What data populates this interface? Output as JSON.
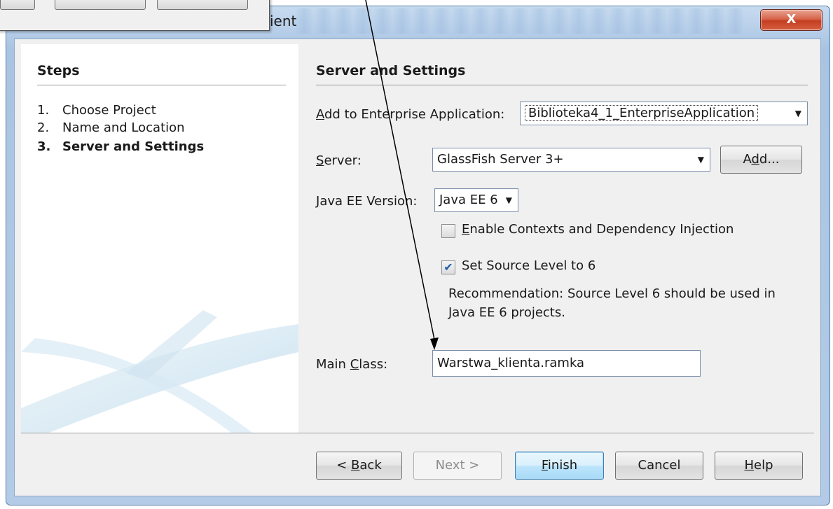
{
  "window": {
    "title_partial": "ient",
    "close_glyph": "X"
  },
  "steps": {
    "heading": "Steps",
    "items": [
      {
        "num": "1.",
        "label": "Choose Project"
      },
      {
        "num": "2.",
        "label": "Name and Location"
      },
      {
        "num": "3.",
        "label": "Server and Settings"
      }
    ]
  },
  "section": {
    "heading": "Server and Settings"
  },
  "form": {
    "enterprise_label_pre": "",
    "enterprise_label_u": "A",
    "enterprise_label_post": "dd to Enterprise Application:",
    "enterprise_value": "Biblioteka4_1_EnterpriseApplication",
    "server_label_u": "S",
    "server_label_post": "erver:",
    "server_value": "GlassFish Server 3+",
    "add_label_pre": "A",
    "add_label_u": "d",
    "add_label_post": "d...",
    "javaee_label_u": "J",
    "javaee_label_post": "ava EE Version:",
    "javaee_value": "Java EE 6",
    "cdi_label_u": "E",
    "cdi_label_post": "nable Contexts and Dependency Injection",
    "cdi_checked": false,
    "source_level_label": "Set Source Level to 6",
    "source_level_checked": true,
    "recommendation_line1": "Recommendation: Source Level 6 should be used in",
    "recommendation_line2": "Java EE 6 projects.",
    "mainclass_label_pre": "Main ",
    "mainclass_label_u": "C",
    "mainclass_label_post": "lass:",
    "mainclass_value": "Warstwa_klienta.ramka"
  },
  "buttons": {
    "back_pre": "< ",
    "back_u": "B",
    "back_post": "ack",
    "next": "Next >",
    "finish_u": "F",
    "finish_post": "inish",
    "cancel": "Cancel",
    "help_u": "H",
    "help_post": "elp"
  },
  "colors": {
    "frame": "#b9d0ea",
    "close_button": "#c43f22",
    "dialog_bg": "#f0f0f0",
    "checkbox_check": "#1d5fa8"
  }
}
